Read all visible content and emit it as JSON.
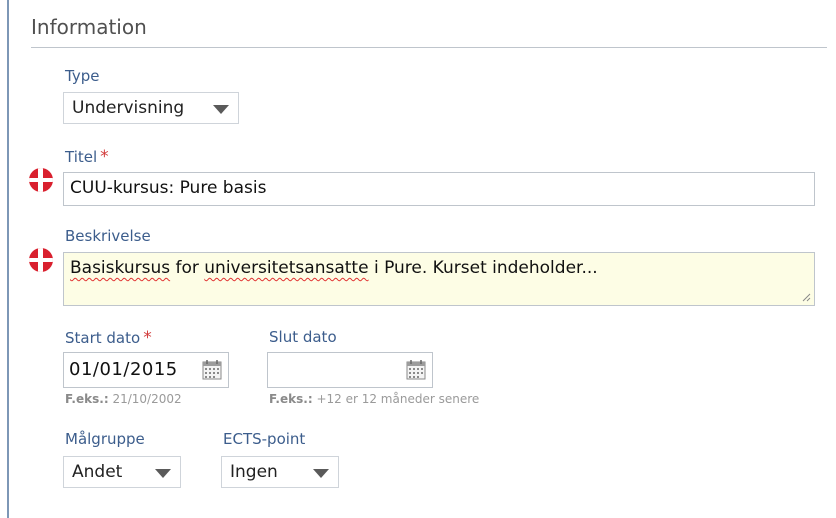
{
  "section": {
    "title": "Information"
  },
  "type_field": {
    "label": "Type",
    "value": "Undervisning"
  },
  "title_field": {
    "label": "Titel",
    "required_mark": "*",
    "value": "CUU-kursus: Pure basis"
  },
  "description_field": {
    "label": "Beskrivelse",
    "value_part1": "Basiskursus",
    "value_part2": " for ",
    "value_part3": "universitetsansatte",
    "value_part4": " i Pure. Kurset indeholder..."
  },
  "start_date": {
    "label": "Start dato",
    "required_mark": "*",
    "value": "01/01/2015",
    "hint_prefix": "F.eks.:",
    "hint_text": " 21/10/2002"
  },
  "end_date": {
    "label": "Slut dato",
    "value": "",
    "hint_prefix": "F.eks.:",
    "hint_text": " +12 er 12 måneder senere"
  },
  "target_group": {
    "label": "Målgruppe",
    "value": "Andet"
  },
  "ects": {
    "label": "ECTS-point",
    "value": "Ingen"
  },
  "colors": {
    "label_blue": "#3c5d8c",
    "required_red": "#d23a3a",
    "flag_red": "#d9202e",
    "textarea_bg": "#fdfde5"
  },
  "icons": {
    "language_flag": "danish-flag-icon",
    "calendar": "calendar-icon",
    "dropdown": "chevron-down-icon"
  }
}
